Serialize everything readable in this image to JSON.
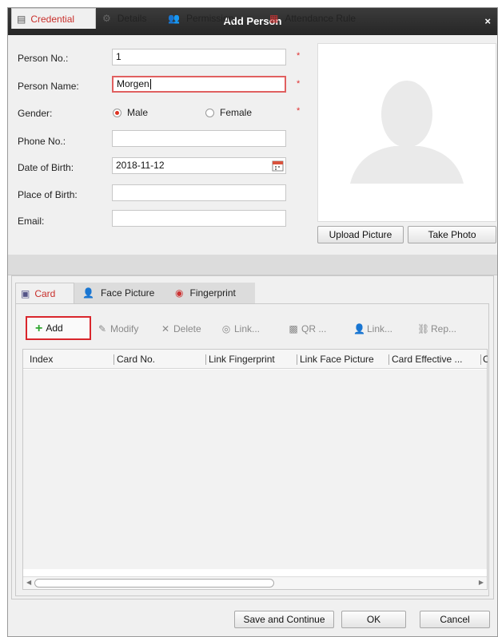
{
  "dialog": {
    "title": "Add Person",
    "close": "×"
  },
  "form": {
    "person_no": {
      "label": "Person No.:",
      "value": "1"
    },
    "person_name": {
      "label": "Person Name:",
      "value": "Morgen"
    },
    "gender": {
      "label": "Gender:",
      "male": "Male",
      "female": "Female",
      "selected": "Male"
    },
    "phone": {
      "label": "Phone No.:",
      "value": ""
    },
    "dob": {
      "label": "Date of Birth:",
      "value": "2018-11-12"
    },
    "pob": {
      "label": "Place of Birth:",
      "value": ""
    },
    "email": {
      "label": "Email:",
      "value": ""
    },
    "required_mark": "*"
  },
  "photo": {
    "upload_label": "Upload Picture",
    "take_label": "Take Photo"
  },
  "main_tabs": [
    "Credential",
    "Details",
    "Permission",
    "Attendance Rule"
  ],
  "sub_tabs": [
    "Card",
    "Face Picture",
    "Fingerprint"
  ],
  "toolbar": {
    "add": "Add",
    "modify": "Modify",
    "delete": "Delete",
    "link1": "Link...",
    "qr": "QR ...",
    "link2": "Link...",
    "rep": "Rep..."
  },
  "table": {
    "columns": [
      "Index",
      "Card No.",
      "Link Fingerprint",
      "Link Face Picture",
      "Card Effective ...",
      "C"
    ]
  },
  "footer": {
    "save_continue": "Save and Continue",
    "ok": "OK",
    "cancel": "Cancel"
  },
  "colors": {
    "accent": "#c9302c",
    "required": "#e03030",
    "add_plus": "#2ea52e",
    "titlebar": "#2b2b2b"
  }
}
